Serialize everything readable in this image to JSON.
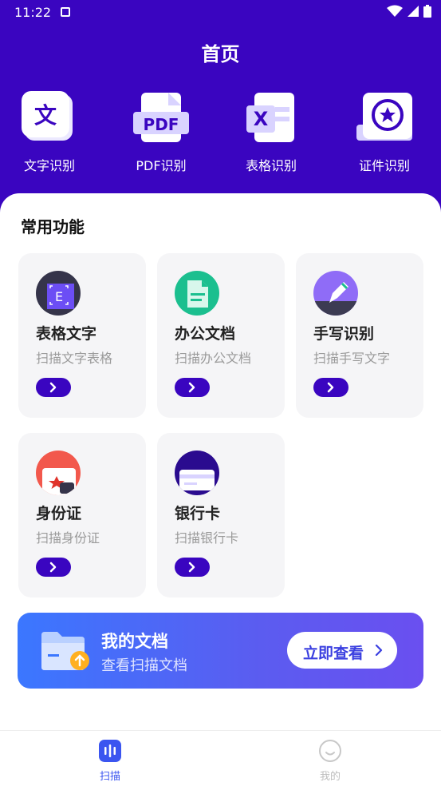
{
  "status": {
    "time": "11:22"
  },
  "header": {
    "title": "首页"
  },
  "quick_actions": [
    {
      "label": "文字识别",
      "icon": "text-doc-icon",
      "glyph": "文"
    },
    {
      "label": "PDF识别",
      "icon": "pdf-icon",
      "glyph": "PDF"
    },
    {
      "label": "表格识别",
      "icon": "excel-icon",
      "glyph": "X"
    },
    {
      "label": "证件识别",
      "icon": "id-badge-icon"
    }
  ],
  "common": {
    "title": "常用功能",
    "cards": [
      {
        "title": "表格文字",
        "subtitle": "扫描文字表格",
        "icon": "table-scan-icon",
        "glyph": "E"
      },
      {
        "title": "办公文档",
        "subtitle": "扫描办公文档",
        "icon": "office-doc-icon"
      },
      {
        "title": "手写识别",
        "subtitle": "扫描手写文字",
        "icon": "handwriting-icon"
      },
      {
        "title": "身份证",
        "subtitle": "扫描身份证",
        "icon": "id-card-icon"
      },
      {
        "title": "银行卡",
        "subtitle": "扫描银行卡",
        "icon": "bank-card-icon"
      }
    ]
  },
  "banner": {
    "title": "我的文档",
    "subtitle": "查看扫描文档",
    "button": "立即查看"
  },
  "tabbar": [
    {
      "label": "扫描",
      "icon": "scan-icon",
      "active": true
    },
    {
      "label": "我的",
      "icon": "profile-icon",
      "active": false
    }
  ],
  "colors": {
    "primary": "#3a05c0",
    "accent": "#3b77ff",
    "inactive": "#bdbdbd"
  }
}
